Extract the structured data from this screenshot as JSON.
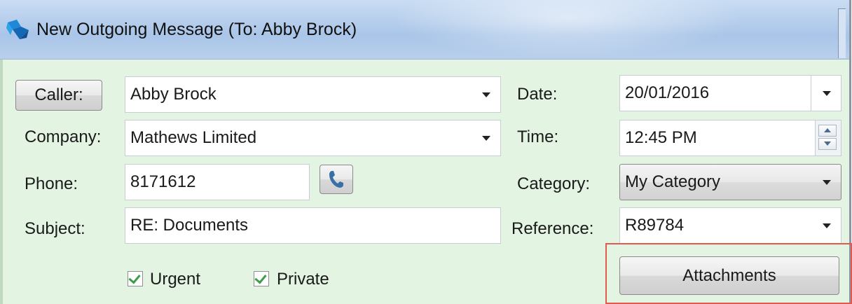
{
  "window": {
    "title": "New Outgoing Message (To: Abby Brock)",
    "icon": "app-logo-icon"
  },
  "form": {
    "caller_button": "Caller:",
    "caller_value": "Abby Brock",
    "company_label": "Company:",
    "company_value": "Mathews Limited",
    "phone_label": "Phone:",
    "phone_value": "8171612",
    "phone_icon": "phone-icon",
    "subject_label": "Subject:",
    "subject_value": "RE: Documents",
    "urgent_label": "Urgent",
    "urgent_checked": true,
    "private_label": "Private",
    "private_checked": true,
    "date_label": "Date:",
    "date_value": "20/01/2016",
    "time_label": "Time:",
    "time_value": "12:45 PM",
    "category_label": "Category:",
    "category_value": "My Category",
    "reference_label": "Reference:",
    "reference_value": "R89784",
    "attachments_button": "Attachments"
  },
  "colors": {
    "client_background": "#e3f4e2",
    "highlight_border": "#e05a4f",
    "phone_icon": "#3a6fa5",
    "check": "#3b9e49"
  }
}
